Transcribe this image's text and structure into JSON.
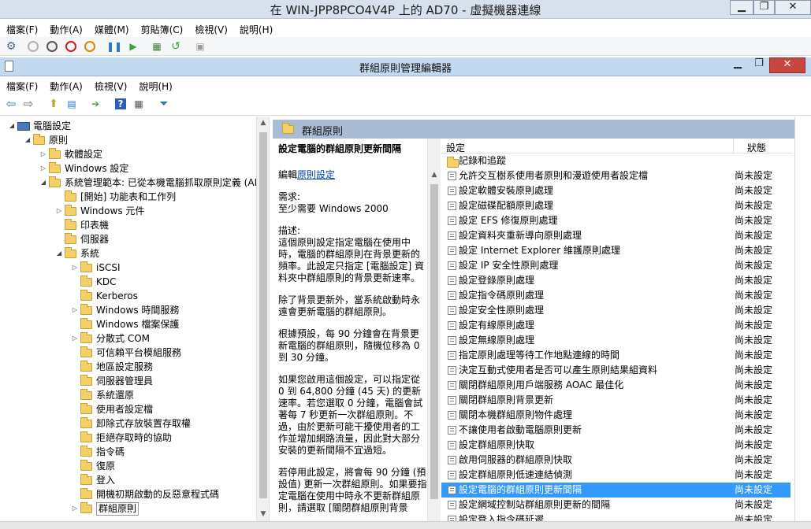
{
  "outer": {
    "title": "在 WIN-JPP8PCO4V4P 上的 AD70 - 虛擬機器連線",
    "menu": [
      "檔案(F)",
      "動作(A)",
      "媒體(M)",
      "剪貼簿(C)",
      "檢視(V)",
      "說明(H)"
    ]
  },
  "inner": {
    "title": "群組原則管理編輯器",
    "menu": [
      "檔案(F)",
      "動作(A)",
      "檢視(V)",
      "說明(H)"
    ]
  },
  "tree": [
    {
      "label": "電腦設定",
      "level": 0,
      "toggle": "◢",
      "icon": "computer"
    },
    {
      "label": "原則",
      "level": 1,
      "toggle": "◢",
      "icon": "folder"
    },
    {
      "label": "軟體設定",
      "level": 2,
      "toggle": "▷",
      "icon": "folder"
    },
    {
      "label": "Windows 設定",
      "level": 2,
      "toggle": "▷",
      "icon": "folder"
    },
    {
      "label": "系統管理範本: 已從本機電腦抓取原則定義 (AD",
      "level": 2,
      "toggle": "◢",
      "icon": "folder"
    },
    {
      "label": "[開始] 功能表和工作列",
      "level": 3,
      "toggle": "",
      "icon": "folder"
    },
    {
      "label": "Windows 元件",
      "level": 3,
      "toggle": "▷",
      "icon": "folder"
    },
    {
      "label": "印表機",
      "level": 3,
      "toggle": "",
      "icon": "folder"
    },
    {
      "label": "伺服器",
      "level": 3,
      "toggle": "",
      "icon": "folder"
    },
    {
      "label": "系統",
      "level": 3,
      "toggle": "◢",
      "icon": "folder"
    },
    {
      "label": "iSCSI",
      "level": 4,
      "toggle": "▷",
      "icon": "folder"
    },
    {
      "label": "KDC",
      "level": 4,
      "toggle": "",
      "icon": "folder"
    },
    {
      "label": "Kerberos",
      "level": 4,
      "toggle": "",
      "icon": "folder"
    },
    {
      "label": "Windows 時間服務",
      "level": 4,
      "toggle": "▷",
      "icon": "folder"
    },
    {
      "label": "Windows 檔案保護",
      "level": 4,
      "toggle": "",
      "icon": "folder"
    },
    {
      "label": "分散式 COM",
      "level": 4,
      "toggle": "▷",
      "icon": "folder"
    },
    {
      "label": "可信賴平台模組服務",
      "level": 4,
      "toggle": "",
      "icon": "folder"
    },
    {
      "label": "地區設定服務",
      "level": 4,
      "toggle": "",
      "icon": "folder"
    },
    {
      "label": "伺服器管理員",
      "level": 4,
      "toggle": "",
      "icon": "folder"
    },
    {
      "label": "系統還原",
      "level": 4,
      "toggle": "",
      "icon": "folder"
    },
    {
      "label": "使用者設定檔",
      "level": 4,
      "toggle": "",
      "icon": "folder"
    },
    {
      "label": "卸除式存放裝置存取權",
      "level": 4,
      "toggle": "",
      "icon": "folder"
    },
    {
      "label": "拒絕存取時的協助",
      "level": 4,
      "toggle": "",
      "icon": "folder"
    },
    {
      "label": "指令碼",
      "level": 4,
      "toggle": "",
      "icon": "folder"
    },
    {
      "label": "復原",
      "level": 4,
      "toggle": "",
      "icon": "folder"
    },
    {
      "label": "登入",
      "level": 4,
      "toggle": "",
      "icon": "folder"
    },
    {
      "label": "開機初期啟動的反惡意程式碼",
      "level": 4,
      "toggle": "",
      "icon": "folder"
    },
    {
      "label": "群組原則",
      "level": 4,
      "toggle": "▷",
      "icon": "folder",
      "selected": true
    }
  ],
  "header": {
    "folder": "群組原則"
  },
  "desc": {
    "title": "設定電腦的群組原則更新間隔",
    "edit_prefix": "編輯",
    "edit_link": "原則設定",
    "req_label": "需求:",
    "req_value": "至少需要 Windows 2000",
    "desc_label": "描述:",
    "p1": "這個原則設定指定電腦在使用中時，電腦的群組原則在背景更新的頻率。此設定只指定 [電腦設定] 資料夾中群組原則的背景更新速率。",
    "p2": "除了背景更新外，當系統啟動時永遠會更新電腦的群組原則。",
    "p3": "根據預設，每 90 分鐘會在背景更新電腦的群組原則，隨機位移為 0 到 30 分鐘。",
    "p4": "如果您啟用這個設定，可以指定從 0 到 64,800 分鐘 (45 天) 的更新速率。若您選取 0 分鐘，電腦會試著每 7 秒更新一次群組原則。不過，由於更新可能干擾使用者的工作並增加網路流量，因此對大部分安裝的更新間隔不宜過短。",
    "p5": "若停用此設定，將會每 90 分鐘 (預設值) 更新一次群組原則。如果要指定電腦在使用中時永不更新群組原則，請選取 [關閉群組原則背景"
  },
  "list": {
    "col_setting": "設定",
    "col_state": "狀態",
    "folder_row": "記錄和追蹤",
    "rows": [
      {
        "name": "允許交互樹系使用者原則和漫遊使用者設定檔",
        "state": "尚未設定"
      },
      {
        "name": "設定軟體安裝原則處理",
        "state": "尚未設定"
      },
      {
        "name": "設定磁碟配額原則處理",
        "state": "尚未設定"
      },
      {
        "name": "設定 EFS 修復原則處理",
        "state": "尚未設定"
      },
      {
        "name": "設定資料夾重新導向原則處理",
        "state": "尚未設定"
      },
      {
        "name": "設定 Internet Explorer 維護原則處理",
        "state": "尚未設定"
      },
      {
        "name": "設定 IP 安全性原則處理",
        "state": "尚未設定"
      },
      {
        "name": "設定登錄原則處理",
        "state": "尚未設定"
      },
      {
        "name": "設定指令碼原則處理",
        "state": "尚未設定"
      },
      {
        "name": "設定安全性原則處理",
        "state": "尚未設定"
      },
      {
        "name": "設定有線原則處理",
        "state": "尚未設定"
      },
      {
        "name": "設定無線原則處理",
        "state": "尚未設定"
      },
      {
        "name": "指定原則處理等待工作地點連線的時間",
        "state": "尚未設定"
      },
      {
        "name": "決定互動式使用者是否可以產生原則結果組資料",
        "state": "尚未設定"
      },
      {
        "name": "關閉群組原則用戶端服務 AOAC 最佳化",
        "state": "尚未設定"
      },
      {
        "name": "關閉群組原則背景更新",
        "state": "尚未設定"
      },
      {
        "name": "關閉本機群組原則物件處理",
        "state": "尚未設定"
      },
      {
        "name": "不讓使用者啟動電腦原則更新",
        "state": "尚未設定"
      },
      {
        "name": "設定群組原則快取",
        "state": "尚未設定"
      },
      {
        "name": "啟用伺服器的群組原則快取",
        "state": "尚未設定"
      },
      {
        "name": "設定群組原則低速連結偵測",
        "state": "尚未設定"
      },
      {
        "name": "設定電腦的群組原則更新間隔",
        "state": "尚未設定",
        "selected": true
      },
      {
        "name": "設定網域控制站群組原則更新的間隔",
        "state": "尚未設定"
      },
      {
        "name": "設定登入指令碼延遲",
        "state": "尚未設定"
      }
    ]
  },
  "colors": {
    "selection": "#3399ff",
    "link": "#0645ad",
    "inner_title": "#c3d9ef"
  }
}
